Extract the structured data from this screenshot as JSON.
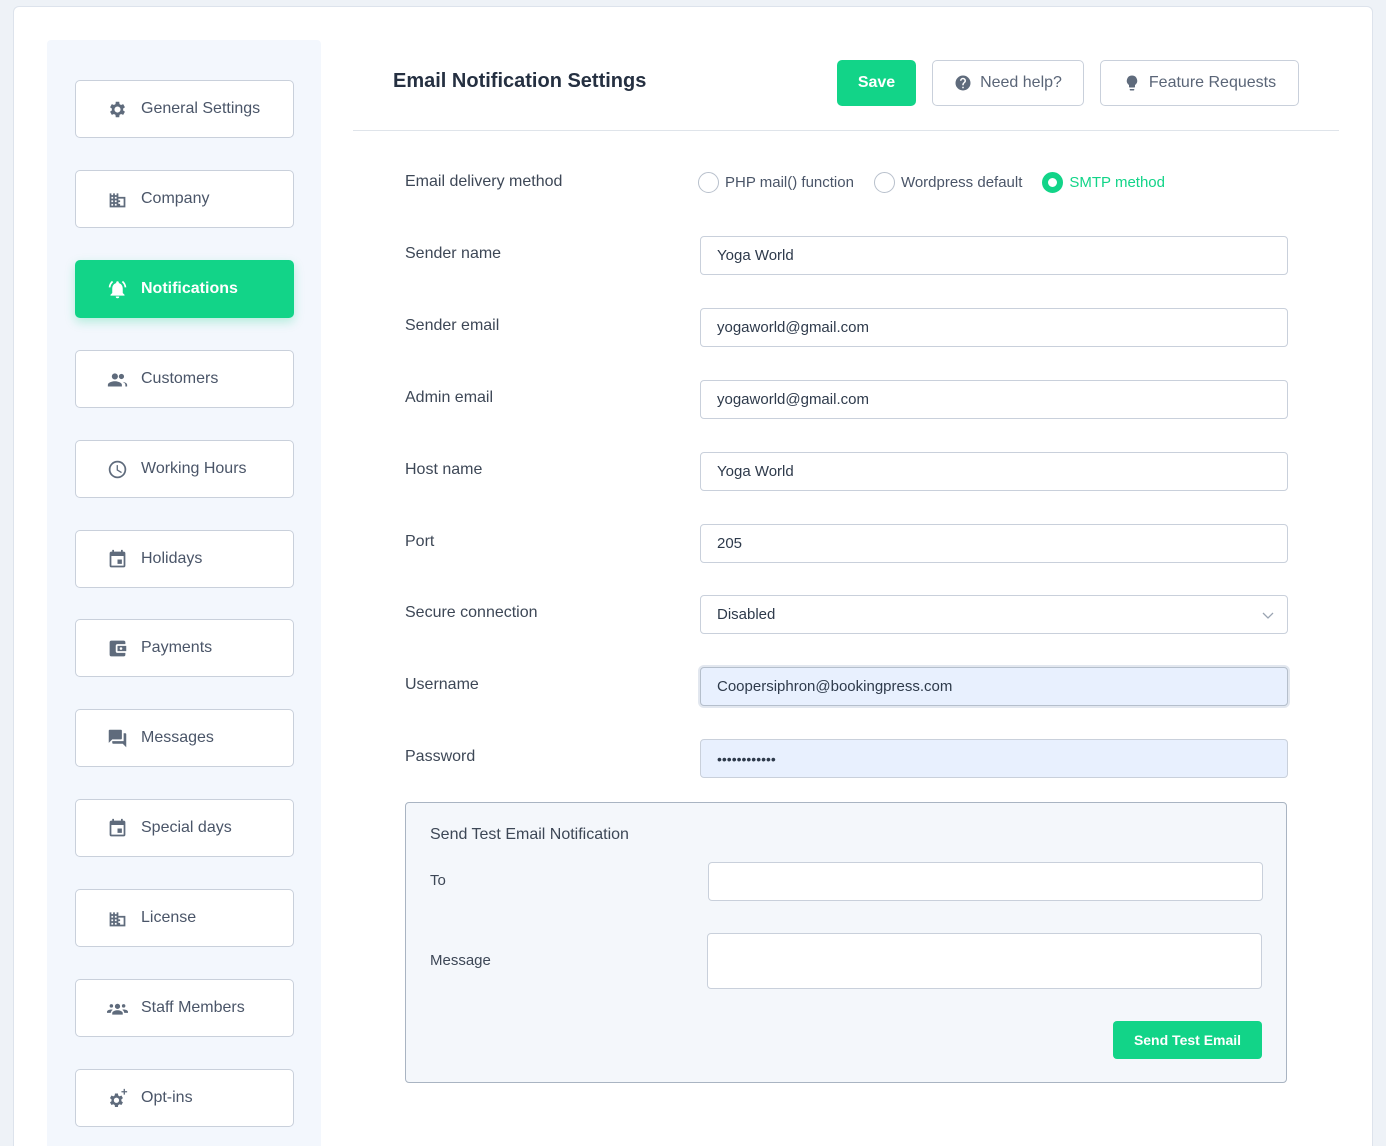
{
  "header": {
    "title": "Email Notification Settings",
    "save_label": "Save",
    "help_label": "Need help?",
    "feature_label": "Feature Requests"
  },
  "sidebar": {
    "items": [
      {
        "label": "General Settings",
        "icon": "gear-icon"
      },
      {
        "label": "Company",
        "icon": "building-icon"
      },
      {
        "label": "Notifications",
        "icon": "bell-icon",
        "active": true
      },
      {
        "label": "Customers",
        "icon": "users-icon"
      },
      {
        "label": "Working Hours",
        "icon": "clock-icon"
      },
      {
        "label": "Holidays",
        "icon": "calendar-icon"
      },
      {
        "label": "Payments",
        "icon": "wallet-icon"
      },
      {
        "label": "Messages",
        "icon": "chat-icon"
      },
      {
        "label": "Special days",
        "icon": "calendar-icon"
      },
      {
        "label": "License",
        "icon": "building-icon"
      },
      {
        "label": "Staff Members",
        "icon": "group-icon"
      },
      {
        "label": "Opt-ins",
        "icon": "gear-plus-icon"
      }
    ]
  },
  "form": {
    "delivery_label": "Email delivery method",
    "delivery_options": [
      {
        "label": "PHP mail() function",
        "checked": false
      },
      {
        "label": "Wordpress default",
        "checked": false
      },
      {
        "label": "SMTP method",
        "checked": true
      }
    ],
    "sender_name_label": "Sender name",
    "sender_name_value": "Yoga World",
    "sender_email_label": "Sender email",
    "sender_email_value": "yogaworld@gmail.com",
    "admin_email_label": "Admin email",
    "admin_email_value": "yogaworld@gmail.com",
    "host_label": "Host name",
    "host_value": "Yoga World",
    "port_label": "Port",
    "port_value": "205",
    "secure_label": "Secure connection",
    "secure_value": "Disabled",
    "username_label": "Username",
    "username_value": "Coopersiphron@bookingpress.com",
    "password_label": "Password",
    "password_value": "••••••••••••"
  },
  "test_email": {
    "title": "Send Test Email Notification",
    "to_label": "To",
    "message_label": "Message",
    "send_label": "Send Test Email"
  },
  "colors": {
    "accent": "#12d488",
    "autofill": "#e8f0fe"
  }
}
